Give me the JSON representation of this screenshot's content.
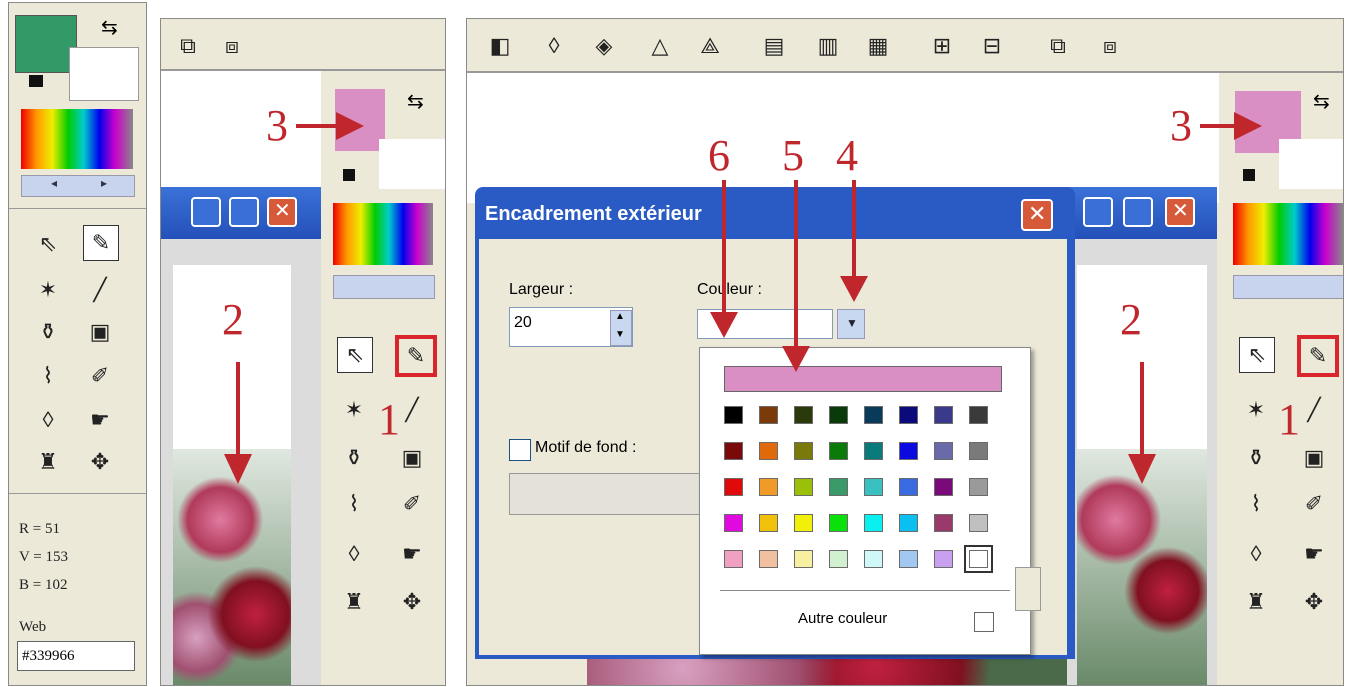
{
  "left_panel": {
    "foreground_color": "#339966",
    "rgb": {
      "r_label": "R = 51",
      "v_label": "V = 153",
      "b_label": "B = 102"
    },
    "web_label": "Web",
    "web_value": "#339966"
  },
  "annotations": {
    "n1": "1",
    "n2": "2",
    "n3": "3",
    "n4": "4",
    "n5": "5",
    "n6": "6"
  },
  "dialog": {
    "title": "Encadrement extérieur",
    "width_label": "Largeur :",
    "width_value": "20",
    "color_label": "Couleur :",
    "motif_label": "Motif de fond :",
    "selected_color": "#d98fc4",
    "other_color_label": "Autre couleur"
  },
  "palette": [
    [
      "#000000",
      "#7a3a0a",
      "#2a3a0a",
      "#0a3a0a",
      "#0a3a5a",
      "#0a0a7a",
      "#3a3a8a",
      "#3a3a3a"
    ],
    [
      "#7a0a0a",
      "#e06a0a",
      "#7a7a0a",
      "#0a7a0a",
      "#0a7a7a",
      "#0a0ae0",
      "#6a6aaa",
      "#7a7a7a"
    ],
    [
      "#e00a0a",
      "#f09a2a",
      "#9ac00a",
      "#3a9a6a",
      "#3ac0c0",
      "#3a6ae0",
      "#7a0a7a",
      "#9a9a9a"
    ],
    [
      "#e00ae0",
      "#f0c00a",
      "#f0f00a",
      "#0ae00a",
      "#0af0f0",
      "#0ac0f0",
      "#9a3a6a",
      "#c0c0c0"
    ],
    [
      "#f0a0c0",
      "#f0c0a0",
      "#f8f0a0",
      "#d0f0d0",
      "#d0f8f8",
      "#a0c8f0",
      "#c8a0f0",
      "#ffffff"
    ]
  ],
  "colors": {
    "dialog_title_bg": "#2a5bc4",
    "panel_bg": "#ece9d8",
    "annotation": "#c0272d",
    "secondary_swatch": "#d98fc4"
  }
}
